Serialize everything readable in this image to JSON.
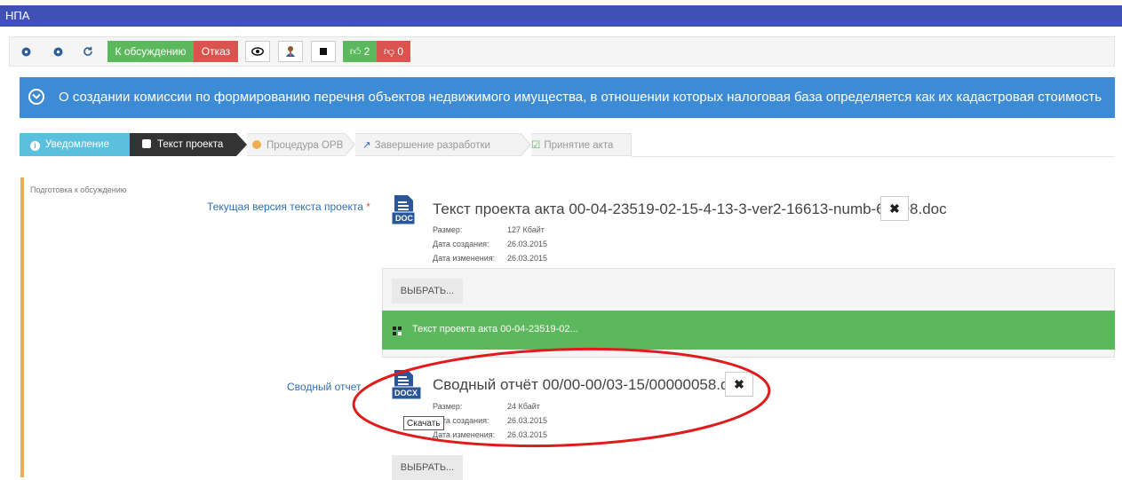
{
  "app": {
    "title": "НПА"
  },
  "toolbar": {
    "icons": [
      "circle-left-icon",
      "circle-right-icon",
      "refresh-icon"
    ],
    "discuss_label": "К обсуждению",
    "reject_label": "Отказ",
    "like_count": "2",
    "dislike_count": "0",
    "colors": {
      "discuss": "#5cb85c",
      "reject": "#d9534f"
    }
  },
  "banner": {
    "title": "О создании комиссии по формированию перечня объектов недвижимого имущества, в отношении которых налоговая база определяется как их кадастровая стоимость"
  },
  "steps": [
    {
      "label": "Уведомление",
      "state": "done"
    },
    {
      "label": "Текст проекта",
      "state": "active"
    },
    {
      "label": "Процедура ОРВ",
      "state": "pending"
    },
    {
      "label": "Завершение разработки",
      "state": "pending"
    },
    {
      "label": "Принятие акта",
      "state": "pending"
    }
  ],
  "section": {
    "label": "Подготовка к обсуждению",
    "text_field": {
      "label": "Текущая версия текста проекта",
      "required_mark": "*",
      "file": {
        "icon_text": "DOC",
        "name": "Текст проекта акта 00-04-23519-02-15-4-13-3-ver2-16613-numb-69998.doc",
        "size_label": "Размер:",
        "size": "127 Кбайт",
        "created_label": "Дата создания:",
        "created": "26.03.2015",
        "modified_label": "Дата изменения:",
        "modified": "26.03.2015"
      },
      "choose_label": "ВЫБРАТЬ...",
      "upload_text": "Текст проекта акта 00-04-23519-02..."
    },
    "report_field": {
      "label": "Сводный отчет",
      "file": {
        "icon_text": "DOCX",
        "name": "Сводный отчёт 00/00-00/03-15/00000058.docx",
        "size_label": "Размер:",
        "size": "24 Кбайт",
        "created_label": "Дата создания:",
        "created": "26.03.2015",
        "modified_label": "Дата изменения:",
        "modified": "26.03.2015"
      },
      "tooltip": "Скачать",
      "choose_label": "ВЫБРАТЬ..."
    }
  }
}
